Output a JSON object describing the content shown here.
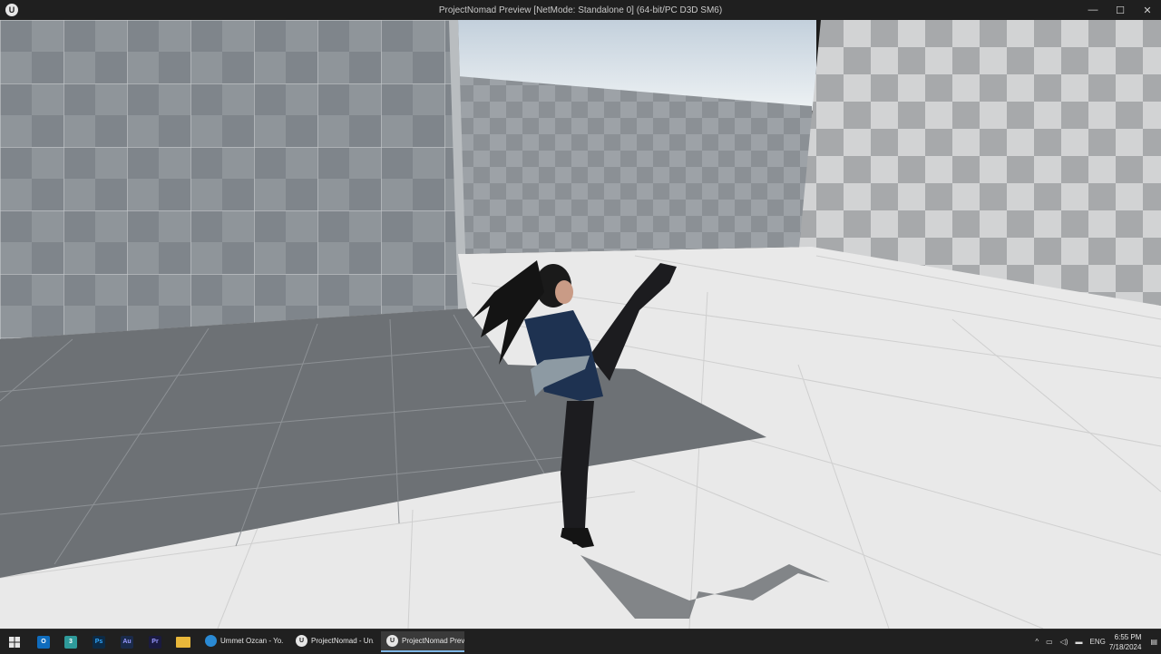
{
  "window": {
    "title": "ProjectNomad Preview [NetMode: Standalone 0]  (64-bit/PC D3D SM6)",
    "logo_letter": "U",
    "minimize_glyph": "—",
    "maximize_glyph": "☐",
    "close_glyph": "✕"
  },
  "taskbar": {
    "start_icon": "windows-start-icon",
    "pinned": [
      {
        "name": "outlook-icon",
        "glyph": "O",
        "color": "#0f6cbd"
      },
      {
        "name": "app-3-icon",
        "glyph": "3",
        "color": "#2e9a9a"
      },
      {
        "name": "photoshop-icon",
        "glyph": "Ps",
        "color": "#0c2a45"
      },
      {
        "name": "audition-icon",
        "glyph": "Au",
        "color": "#1a2a4a"
      },
      {
        "name": "premiere-icon",
        "glyph": "Pr",
        "color": "#1a1a40"
      },
      {
        "name": "file-explorer-icon",
        "glyph": "",
        "color": "#e8b73a"
      }
    ],
    "tasks": [
      {
        "name": "task-edge",
        "label": "Ummet Ozcan - Yo...",
        "icon": "edge-icon",
        "icon_color": "#2a8ad4",
        "active": false
      },
      {
        "name": "task-unreal-editor",
        "label": "ProjectNomad - Un...",
        "icon": "unreal-icon",
        "icon_color": "#e6e6e6",
        "active": false
      },
      {
        "name": "task-projectnomad-preview",
        "label": "ProjectNomad Previ...",
        "icon": "unreal-icon",
        "icon_color": "#e6e6e6",
        "active": true
      }
    ],
    "tray": {
      "chevron": "^",
      "language": "ENG",
      "time": "6:55 PM",
      "date": "7/18/2024"
    }
  },
  "scene": {
    "sky_top": "#c9d5df",
    "sky_bottom": "#e9eef1",
    "floor_lit": "#e8e8e8",
    "floor_shadow": "#6e7276",
    "wall_dark": "#8d9297",
    "wall_light": "#d5d6d7",
    "character_outfit": "#1e3251",
    "character_legs": "#1b1b1d"
  }
}
